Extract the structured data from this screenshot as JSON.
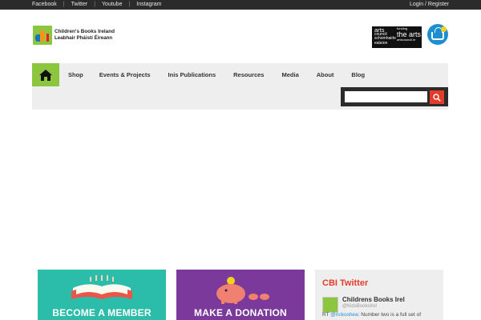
{
  "topbar": {
    "social": [
      "Facebook",
      "Twitter",
      "Youtube",
      "Instagram"
    ],
    "separator": "|",
    "login": "Login / Register"
  },
  "logo": {
    "line1": "Children's Books Ireland",
    "line2": "Leabhair Pháistí Éireann"
  },
  "arts_council": {
    "a1": "arts",
    "a2": "council",
    "a3": "schomhairle",
    "a4": "ealaíon",
    "b1": "funding",
    "b2": "the arts",
    "b3": "artscouncil.ie"
  },
  "nav": {
    "items": [
      "Shop",
      "Events & Projects",
      "Inis Publications",
      "Resources",
      "Media",
      "About",
      "Blog"
    ]
  },
  "search": {
    "placeholder": ""
  },
  "cards": {
    "member": "BECOME A MEMBER",
    "donate": "MAKE A DONATION"
  },
  "twitter": {
    "title": "CBI Twitter",
    "name": "Childrens Books Irel",
    "handle": "@KidsBooksIrel",
    "tweet_prefix": "RT",
    "mention": "@rickoshea",
    "tweet_body": ": Number two is a full set of"
  },
  "colors": {
    "green": "#8cc63f",
    "red": "#e43b2b",
    "teal": "#2bbcaa",
    "purple": "#7b3a9b",
    "dark": "#2b2b2b"
  },
  "icons": [
    "home-icon",
    "search-icon",
    "basket-icon",
    "book-icon",
    "piggy-bank-icon"
  ]
}
